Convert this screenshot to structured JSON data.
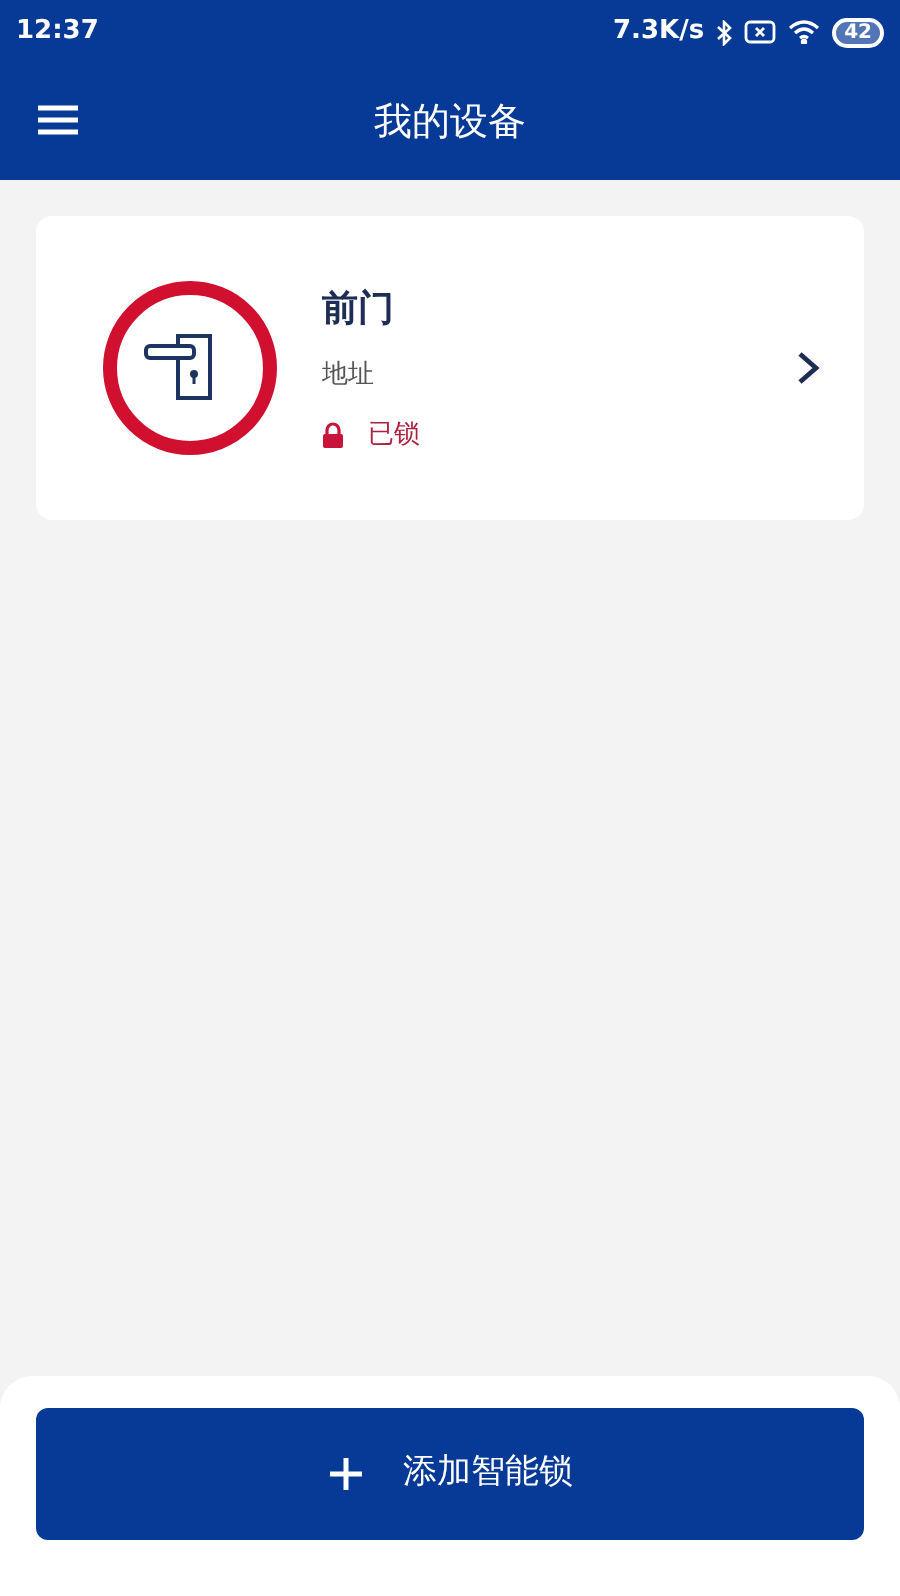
{
  "status_bar": {
    "time": "12:37",
    "speed": "7.3K/s",
    "battery": "42"
  },
  "header": {
    "title": "我的设备"
  },
  "devices": [
    {
      "name": "前门",
      "address": "地址",
      "status": "已锁",
      "locked": true
    }
  ],
  "add_button": {
    "label": "添加智能锁"
  }
}
